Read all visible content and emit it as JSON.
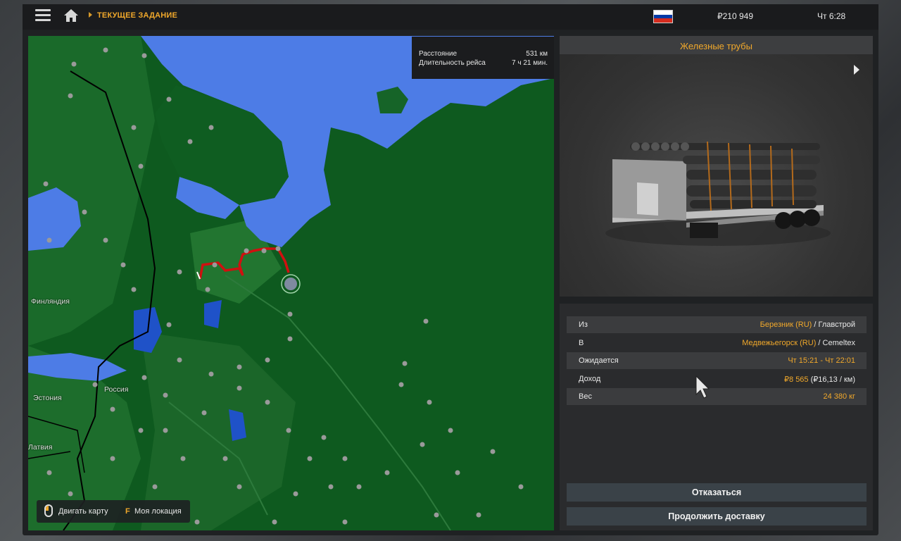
{
  "topbar": {
    "breadcrumb": "ТЕКУЩЕЕ ЗАДАНИЕ",
    "money": "₽210 949",
    "clock": "Чт 6:28",
    "flag_colors": [
      "#ffffff",
      "#0039a6",
      "#d52b1e"
    ],
    "icons": [
      "menu-icon",
      "home-icon"
    ]
  },
  "map": {
    "info": {
      "distance_label": "Расстояние",
      "distance_value": "531 км",
      "duration_label": "Длительность рейса",
      "duration_value": "7 ч 21 мин."
    },
    "labels": {
      "finland": "Финляндия",
      "russia": "Россия",
      "estonia": "Эстония",
      "latvia": "Латвия"
    },
    "hints": {
      "move_map": "Двигать карту",
      "key": "F",
      "my_location": "Моя локация"
    },
    "colors": {
      "land": "#0e5a1f",
      "water": "#4d7ce6",
      "route": "#d01010"
    }
  },
  "cargo": {
    "title": "Железные трубы"
  },
  "details": {
    "from_label": "Из",
    "from_city": "Березник (RU)",
    "from_company": " / Главстрой",
    "to_label": "В",
    "to_city": "Медвежьегорск (RU)",
    "to_company": " / Cemeltex",
    "expected_label": "Ожидается",
    "expected_value": "Чт 15:21 - Чт 22:01",
    "income_label": "Доход",
    "income_value": "₽8 565",
    "income_rate": " (₽16,13 / км)",
    "weight_label": "Вес",
    "weight_value": "24 380 кг"
  },
  "buttons": {
    "decline": "Отказаться",
    "continue": "Продолжить доставку"
  },
  "accent": "#f0a82b"
}
